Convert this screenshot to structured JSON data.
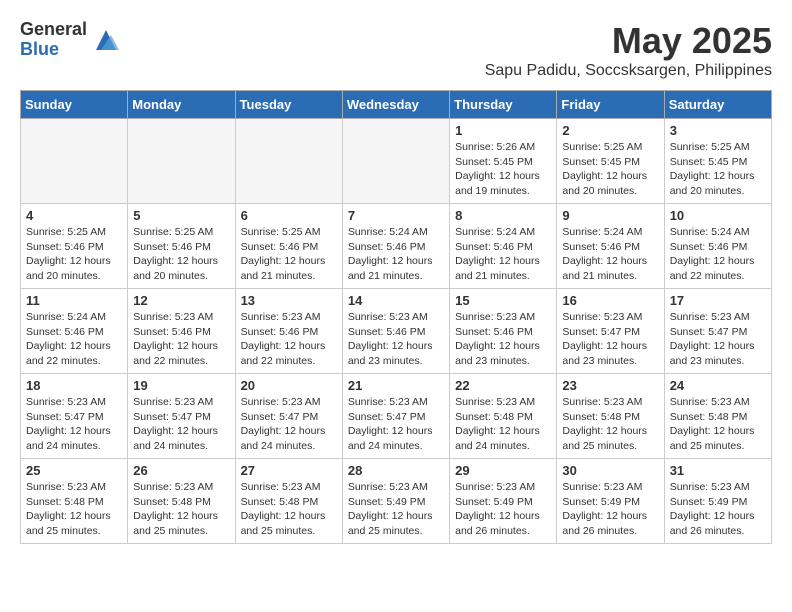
{
  "logo": {
    "general": "General",
    "blue": "Blue"
  },
  "title": "May 2025",
  "subtitle": "Sapu Padidu, Soccsksargen, Philippines",
  "days_of_week": [
    "Sunday",
    "Monday",
    "Tuesday",
    "Wednesday",
    "Thursday",
    "Friday",
    "Saturday"
  ],
  "weeks": [
    [
      {
        "day": "",
        "empty": true
      },
      {
        "day": "",
        "empty": true
      },
      {
        "day": "",
        "empty": true
      },
      {
        "day": "",
        "empty": true
      },
      {
        "day": "1",
        "sunrise": "5:26 AM",
        "sunset": "5:45 PM",
        "daylight": "12 hours and 19 minutes."
      },
      {
        "day": "2",
        "sunrise": "5:25 AM",
        "sunset": "5:45 PM",
        "daylight": "12 hours and 20 minutes."
      },
      {
        "day": "3",
        "sunrise": "5:25 AM",
        "sunset": "5:45 PM",
        "daylight": "12 hours and 20 minutes."
      }
    ],
    [
      {
        "day": "4",
        "sunrise": "5:25 AM",
        "sunset": "5:46 PM",
        "daylight": "12 hours and 20 minutes."
      },
      {
        "day": "5",
        "sunrise": "5:25 AM",
        "sunset": "5:46 PM",
        "daylight": "12 hours and 20 minutes."
      },
      {
        "day": "6",
        "sunrise": "5:25 AM",
        "sunset": "5:46 PM",
        "daylight": "12 hours and 21 minutes."
      },
      {
        "day": "7",
        "sunrise": "5:24 AM",
        "sunset": "5:46 PM",
        "daylight": "12 hours and 21 minutes."
      },
      {
        "day": "8",
        "sunrise": "5:24 AM",
        "sunset": "5:46 PM",
        "daylight": "12 hours and 21 minutes."
      },
      {
        "day": "9",
        "sunrise": "5:24 AM",
        "sunset": "5:46 PM",
        "daylight": "12 hours and 21 minutes."
      },
      {
        "day": "10",
        "sunrise": "5:24 AM",
        "sunset": "5:46 PM",
        "daylight": "12 hours and 22 minutes."
      }
    ],
    [
      {
        "day": "11",
        "sunrise": "5:24 AM",
        "sunset": "5:46 PM",
        "daylight": "12 hours and 22 minutes."
      },
      {
        "day": "12",
        "sunrise": "5:23 AM",
        "sunset": "5:46 PM",
        "daylight": "12 hours and 22 minutes."
      },
      {
        "day": "13",
        "sunrise": "5:23 AM",
        "sunset": "5:46 PM",
        "daylight": "12 hours and 22 minutes."
      },
      {
        "day": "14",
        "sunrise": "5:23 AM",
        "sunset": "5:46 PM",
        "daylight": "12 hours and 23 minutes."
      },
      {
        "day": "15",
        "sunrise": "5:23 AM",
        "sunset": "5:46 PM",
        "daylight": "12 hours and 23 minutes."
      },
      {
        "day": "16",
        "sunrise": "5:23 AM",
        "sunset": "5:47 PM",
        "daylight": "12 hours and 23 minutes."
      },
      {
        "day": "17",
        "sunrise": "5:23 AM",
        "sunset": "5:47 PM",
        "daylight": "12 hours and 23 minutes."
      }
    ],
    [
      {
        "day": "18",
        "sunrise": "5:23 AM",
        "sunset": "5:47 PM",
        "daylight": "12 hours and 24 minutes."
      },
      {
        "day": "19",
        "sunrise": "5:23 AM",
        "sunset": "5:47 PM",
        "daylight": "12 hours and 24 minutes."
      },
      {
        "day": "20",
        "sunrise": "5:23 AM",
        "sunset": "5:47 PM",
        "daylight": "12 hours and 24 minutes."
      },
      {
        "day": "21",
        "sunrise": "5:23 AM",
        "sunset": "5:47 PM",
        "daylight": "12 hours and 24 minutes."
      },
      {
        "day": "22",
        "sunrise": "5:23 AM",
        "sunset": "5:48 PM",
        "daylight": "12 hours and 24 minutes."
      },
      {
        "day": "23",
        "sunrise": "5:23 AM",
        "sunset": "5:48 PM",
        "daylight": "12 hours and 25 minutes."
      },
      {
        "day": "24",
        "sunrise": "5:23 AM",
        "sunset": "5:48 PM",
        "daylight": "12 hours and 25 minutes."
      }
    ],
    [
      {
        "day": "25",
        "sunrise": "5:23 AM",
        "sunset": "5:48 PM",
        "daylight": "12 hours and 25 minutes."
      },
      {
        "day": "26",
        "sunrise": "5:23 AM",
        "sunset": "5:48 PM",
        "daylight": "12 hours and 25 minutes."
      },
      {
        "day": "27",
        "sunrise": "5:23 AM",
        "sunset": "5:48 PM",
        "daylight": "12 hours and 25 minutes."
      },
      {
        "day": "28",
        "sunrise": "5:23 AM",
        "sunset": "5:49 PM",
        "daylight": "12 hours and 25 minutes."
      },
      {
        "day": "29",
        "sunrise": "5:23 AM",
        "sunset": "5:49 PM",
        "daylight": "12 hours and 26 minutes."
      },
      {
        "day": "30",
        "sunrise": "5:23 AM",
        "sunset": "5:49 PM",
        "daylight": "12 hours and 26 minutes."
      },
      {
        "day": "31",
        "sunrise": "5:23 AM",
        "sunset": "5:49 PM",
        "daylight": "12 hours and 26 minutes."
      }
    ]
  ]
}
